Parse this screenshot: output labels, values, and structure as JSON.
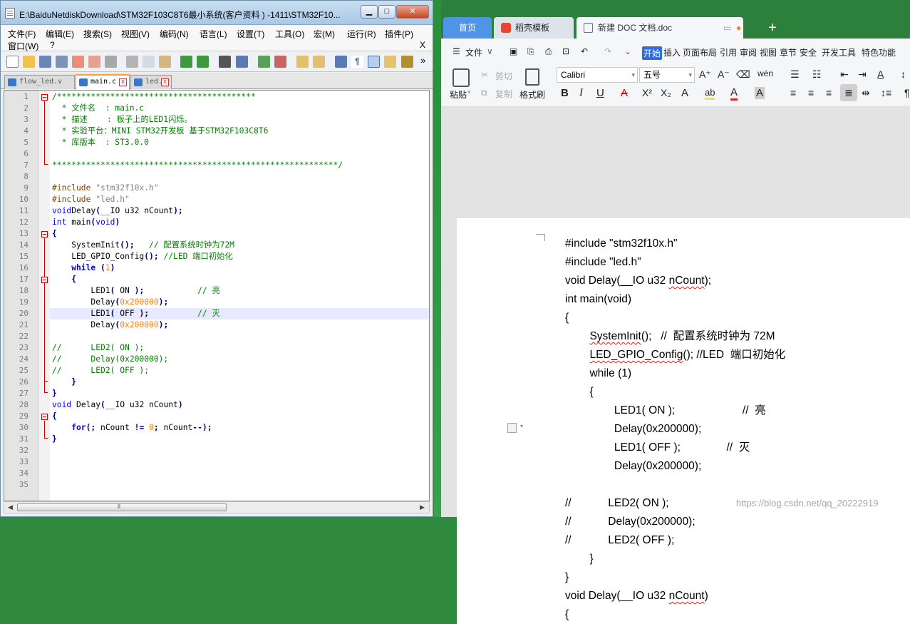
{
  "notepad": {
    "title": "E:\\BaiduNetdiskDownload\\STM32F103C8T6最小系统(客户资料 ) -1411\\STM32F10...",
    "menu": [
      "文件(F)",
      "编辑(E)",
      "搜索(S)",
      "视图(V)",
      "编码(N)",
      "语言(L)",
      "设置(T)",
      "工具(O)",
      "宏(M)",
      "运行(R)",
      "插件(P)"
    ],
    "menu2": [
      "窗口(W)",
      "?"
    ],
    "menu_close": "X",
    "toolbar_more": "»",
    "tabs": [
      "flow_led.v",
      "main.c",
      "led.c"
    ],
    "line_numbers": [
      "1",
      "2",
      "3",
      "4",
      "5",
      "6",
      "7",
      "8",
      "9",
      "10",
      "11",
      "12",
      "13",
      "14",
      "15",
      "16",
      "17",
      "18",
      "19",
      "20",
      "21",
      "22",
      "23",
      "24",
      "25",
      "26",
      "27",
      "28",
      "29",
      "30",
      "31",
      "32",
      "33",
      "34",
      "35"
    ],
    "code": [
      [
        [
          "c-cm",
          "/*****************************************"
        ]
      ],
      [
        [
          "c-cm",
          "  * 文件名  : main.c"
        ]
      ],
      [
        [
          "c-cm",
          "  * 描述    : 板子上的LED1闪烁。"
        ]
      ],
      [
        [
          "c-cm",
          "  * 实验平台：MINI STM32开发板 基于STM32F103C8T6"
        ]
      ],
      [
        [
          "c-cm",
          "  * 库版本  : ST3.0.0"
        ]
      ],
      [],
      [
        [
          "c-cm",
          "***********************************************************/"
        ]
      ],
      [],
      [
        [
          "c-pp",
          "#include "
        ],
        [
          "c-str",
          "\"stm32f10x.h\""
        ]
      ],
      [
        [
          "c-pp",
          "#include "
        ],
        [
          "c-str",
          "\"led.h\""
        ]
      ],
      [
        [
          "c-kw",
          "void"
        ],
        [
          "",
          "Delay"
        ],
        [
          "c-op",
          "("
        ],
        [
          "",
          "__IO u32 nCount"
        ],
        [
          "c-op",
          ");"
        ]
      ],
      [
        [
          "c-kw",
          "int"
        ],
        [
          "",
          " main"
        ],
        [
          "c-op",
          "("
        ],
        [
          "c-kw",
          "void"
        ],
        [
          "c-op",
          ")"
        ]
      ],
      [
        [
          "c-op",
          "{"
        ]
      ],
      [
        [
          "",
          "    SystemInit"
        ],
        [
          "c-op",
          "();"
        ],
        [
          "",
          "   "
        ],
        [
          "c-cm",
          "// 配置系统时钟为72M"
        ]
      ],
      [
        [
          "",
          "    LED_GPIO_Config"
        ],
        [
          "c-op",
          "();"
        ],
        [
          "",
          " "
        ],
        [
          "c-cm",
          "//LED 端口初始化"
        ]
      ],
      [
        [
          "c-kwb",
          "    while"
        ],
        [
          "",
          " "
        ],
        [
          "c-op",
          "("
        ],
        [
          "c-num",
          "1"
        ],
        [
          "c-op",
          ")"
        ]
      ],
      [
        [
          "c-op",
          "    {"
        ]
      ],
      [
        [
          "",
          "        LED1"
        ],
        [
          "c-op",
          "("
        ],
        [
          "",
          " ON "
        ],
        [
          "c-op",
          ");"
        ],
        [
          "",
          "           "
        ],
        [
          "c-cm",
          "// 亮"
        ]
      ],
      [
        [
          "",
          "        Delay"
        ],
        [
          "c-op",
          "("
        ],
        [
          "c-num",
          "0x200000"
        ],
        [
          "c-op",
          ");"
        ]
      ],
      [
        [
          "",
          "        LED1"
        ],
        [
          "c-op",
          "("
        ],
        [
          "",
          " OFF "
        ],
        [
          "c-op",
          ");"
        ],
        [
          "",
          "          "
        ],
        [
          "c-cm",
          "// 灭"
        ]
      ],
      [
        [
          "",
          "        Delay"
        ],
        [
          "c-op",
          "("
        ],
        [
          "c-num",
          "0x200000"
        ],
        [
          "c-op",
          ");"
        ]
      ],
      [],
      [
        [
          "c-cm",
          "//      LED2( ON );"
        ]
      ],
      [
        [
          "c-cm",
          "//      Delay(0x200000);"
        ]
      ],
      [
        [
          "c-cm",
          "//      LED2( OFF );"
        ]
      ],
      [
        [
          "c-op",
          "    }"
        ]
      ],
      [
        [
          "c-op",
          "}"
        ]
      ],
      [
        [
          "c-kw",
          "void"
        ],
        [
          "",
          " Delay"
        ],
        [
          "c-op",
          "("
        ],
        [
          "",
          "__IO u32 nCount"
        ],
        [
          "c-op",
          ")"
        ]
      ],
      [
        [
          "c-op",
          "{"
        ]
      ],
      [
        [
          "c-kwb",
          "    for"
        ],
        [
          "c-op",
          "(;"
        ],
        [
          "",
          " nCount "
        ],
        [
          "c-op",
          "!="
        ],
        [
          "",
          " "
        ],
        [
          "c-num",
          "0"
        ],
        [
          "c-op",
          ";"
        ],
        [
          "",
          " nCount"
        ],
        [
          "c-op",
          "--);"
        ]
      ],
      [
        [
          "c-op",
          "}"
        ]
      ],
      [],
      [],
      [],
      []
    ],
    "scroll_center": "⦀"
  },
  "wps": {
    "tabs": {
      "home": "首页",
      "templates": "稻壳模板",
      "doc": "新建 DOC 文档.doc",
      "add": "+"
    },
    "menu_file": "文件",
    "menu": [
      "开始",
      "插入",
      "页面布局",
      "引用",
      "审阅",
      "视图",
      "章节",
      "安全",
      "开发工具",
      "特色功能"
    ],
    "ribbon": {
      "paste": "粘贴",
      "cut": "剪切",
      "copy": "复制",
      "format_painter": "格式刷",
      "font": "Calibri",
      "size": "五号",
      "bold": "B",
      "italic": "I",
      "underline": "U",
      "strike": "A",
      "sup": "X²",
      "sub": "X₂",
      "font_effect": "A",
      "highlight": "ab",
      "font_color": "A",
      "char_shade": "A",
      "grow": "A⁺",
      "shrink": "A⁻",
      "phonetic": "wén"
    },
    "doc_lines": [
      [
        "#include \"stm32f10x.h\""
      ],
      [
        "#include \"led.h\""
      ],
      [
        "void Delay(__IO u32 nCount);"
      ],
      [
        "int main(void)"
      ],
      [
        "{"
      ],
      [
        "        SystemInit();   //  配置系统时钟为 72M"
      ],
      [
        "        LED_GPIO_Config(); //LED  端口初始化"
      ],
      [
        "        while (1)"
      ],
      [
        "        {"
      ],
      [
        "                LED1( ON );                      //  亮"
      ],
      [
        "                Delay(0x200000);"
      ],
      [
        "                LED1( OFF );               //  灭"
      ],
      [
        "                Delay(0x200000);"
      ],
      [
        ""
      ],
      [
        "//            LED2( ON );"
      ],
      [
        "//            Delay(0x200000);"
      ],
      [
        "//            LED2( OFF );"
      ],
      [
        "        }"
      ],
      [
        "}"
      ],
      [
        "void Delay(__IO u32 nCount)"
      ],
      [
        "{"
      ]
    ]
  },
  "watermark": "https://blog.csdn.net/qq_20222919"
}
